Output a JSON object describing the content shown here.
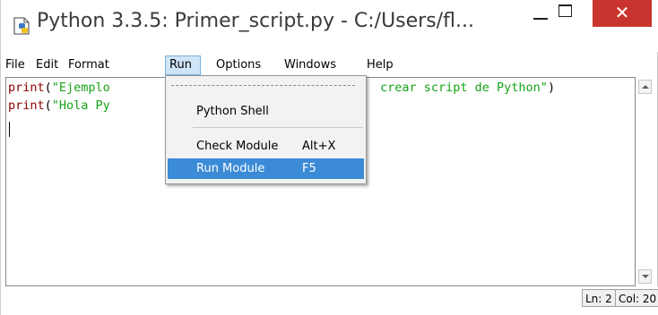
{
  "window": {
    "title": "Python 3.3.5: Primer_script.py - C:/Users/fl...",
    "icon": "python-file-icon",
    "controls": {
      "minimize": "minimize-icon",
      "maximize": "maximize-icon",
      "close": "✕"
    }
  },
  "menubar": {
    "items": [
      "File",
      "Edit",
      "Format",
      "Run",
      "Options",
      "Windows",
      "Help"
    ],
    "active": "Run"
  },
  "editor": {
    "lines": [
      {
        "keyword": "print",
        "open": "(",
        "text": "\"Ejemplo",
        "close": ""
      },
      {
        "keyword": "print",
        "open": "(",
        "text": "\"Hola Py",
        "close": ""
      }
    ],
    "hidden_tail": {
      "text": "crear script de Python\"",
      "close": ")"
    }
  },
  "run_menu": {
    "items": [
      {
        "label": "Python Shell",
        "accel": ""
      },
      {
        "label": "Check Module",
        "accel": "Alt+X"
      },
      {
        "label": "Run Module",
        "accel": "F5",
        "highlighted": true
      }
    ]
  },
  "statusbar": {
    "line": "Ln: 2",
    "col": "Col: 20"
  },
  "colors": {
    "keyword": "#8b0000",
    "string": "#16a316",
    "close_button": "#c9352e",
    "menu_highlight": "#3c8bd7"
  }
}
